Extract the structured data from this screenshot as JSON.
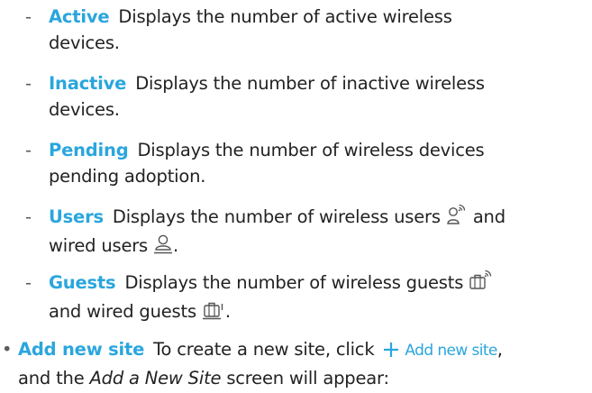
{
  "items": [
    {
      "term": "Active",
      "before": "Displays the number of active wireless",
      "after": "devices."
    },
    {
      "term": "Inactive",
      "before": "Displays the number of inactive wireless",
      "after": "devices."
    },
    {
      "term": "Pending",
      "before": "Displays the number of wireless devices",
      "after": "pending adoption."
    },
    {
      "term": "Users",
      "text_a": "Displays the number of wireless users",
      "text_b": "and",
      "text_c": "wired users",
      "text_d": "."
    },
    {
      "term": "Guests",
      "text_a": "Displays the number of wireless guests",
      "text_b": "and wired guests",
      "text_c": "."
    }
  ],
  "add_site": {
    "term": "Add new site",
    "text_a": "To create a new site, click",
    "link_label": "Add new site",
    "comma": ",",
    "text_b": "and the",
    "screen_name": "Add a New Site",
    "text_c": "screen will appear:"
  },
  "dash": "-",
  "bullet": "•",
  "colors": {
    "accent": "#2aa6dd",
    "text": "#222222",
    "icon": "#555555"
  },
  "icons": [
    "wireless-user-icon",
    "wired-user-icon",
    "wireless-guest-icon",
    "wired-guest-icon",
    "plus-icon"
  ]
}
